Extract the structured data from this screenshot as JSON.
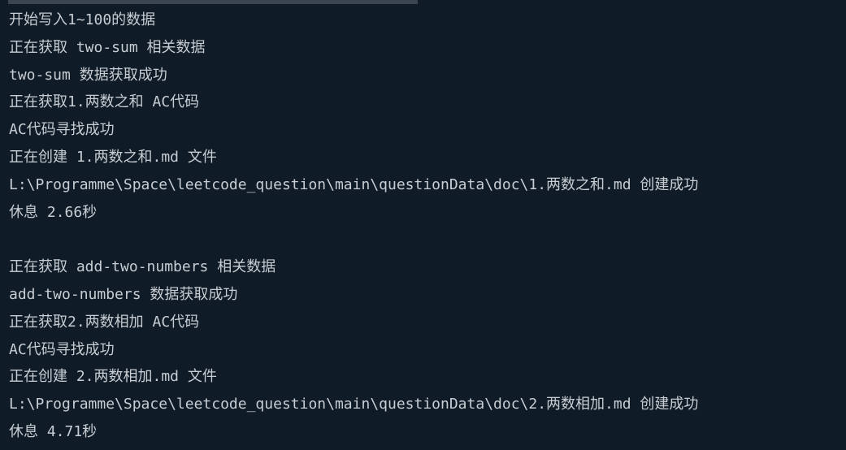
{
  "terminal": {
    "lines": [
      "开始写入1~100的数据",
      "正在获取 two-sum 相关数据",
      "two-sum 数据获取成功",
      "正在获取1.两数之和 AC代码",
      "AC代码寻找成功",
      "正在创建 1.两数之和.md 文件",
      "L:\\Programme\\Space\\leetcode_question\\main\\questionData\\doc\\1.两数之和.md 创建成功",
      "休息 2.66秒",
      "",
      "正在获取 add-two-numbers 相关数据",
      "add-two-numbers 数据获取成功",
      "正在获取2.两数相加 AC代码",
      "AC代码寻找成功",
      "正在创建 2.两数相加.md 文件",
      "L:\\Programme\\Space\\leetcode_question\\main\\questionData\\doc\\2.两数相加.md 创建成功",
      "休息 4.71秒"
    ]
  }
}
